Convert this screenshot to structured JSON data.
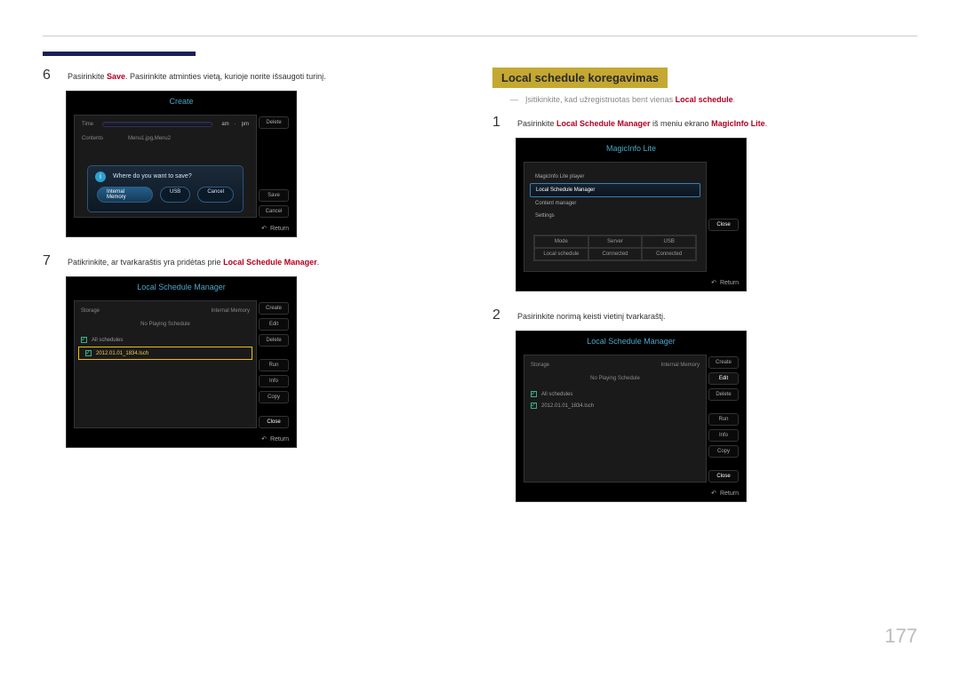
{
  "page_number": "177",
  "left": {
    "step6": {
      "pre": "Pasirinkite ",
      "kw": "Save",
      "post": ". Pasirinkite atminties vietą, kurioje norite išsaugoti turinį."
    },
    "create": {
      "title": "Create",
      "time_label": "Time",
      "am": "am",
      "pm": "pm",
      "contents_label": "Contents",
      "contents_value": "Menu1.jpg,Menu2",
      "side": {
        "delete": "Delete",
        "save": "Save",
        "cancel": "Cancel"
      },
      "dialog": {
        "question": "Where do you want to save?",
        "internal": "Internal Memory",
        "usb": "USB",
        "cancel": "Cancel"
      },
      "return": "Return"
    },
    "step7": {
      "pre": "Patikrinkite, ar tvarkaraštis yra pridėtas prie ",
      "kw": "Local Schedule Manager",
      "post": "."
    },
    "lsm": {
      "title": "Local Schedule Manager",
      "storage": "Storage",
      "storage_val": "Internal Memory",
      "noplay": "No Playing Schedule",
      "all": "All schedules",
      "item": "2012.01.01_1834.lsch",
      "side": {
        "create": "Create",
        "edit": "Edit",
        "delete": "Delete",
        "run": "Run",
        "info": "Info",
        "copy": "Copy",
        "close": "Close"
      },
      "return": "Return"
    }
  },
  "right": {
    "section_title": "Local schedule koregavimas",
    "note_pre": "Įsitikinkite, kad užregistruotas bent vienas ",
    "note_kw": "Local schedule",
    "note_post": ".",
    "step1": {
      "pre": "Pasirinkite ",
      "kw1": "Local Schedule Manager",
      "mid": " iš meniu ekrano ",
      "kw2": "MagicInfo Lite",
      "post": "."
    },
    "mil": {
      "title": "MagicInfo Lite",
      "items": [
        "MagicInfo Lite player",
        "Local Schedule Manager",
        "Content manager",
        "Settings"
      ],
      "close": "Close",
      "grid": {
        "r1": [
          "Mode",
          "Server",
          "USB"
        ],
        "r2": [
          "Local schedule",
          "Connected",
          "Connected"
        ]
      },
      "return": "Return"
    },
    "step2": {
      "text": "Pasirinkite norimą keisti vietinį tvarkaraštį."
    },
    "lsm2": {
      "title": "Local Schedule Manager",
      "storage": "Storage",
      "storage_val": "Internal Memory",
      "noplay": "No Playing Schedule",
      "all": "All schedules",
      "item": "2012.01.01_1834.lsch",
      "side": {
        "create": "Create",
        "edit": "Edit",
        "delete": "Delete",
        "run": "Run",
        "info": "Info",
        "copy": "Copy",
        "close": "Close"
      },
      "return": "Return"
    }
  }
}
